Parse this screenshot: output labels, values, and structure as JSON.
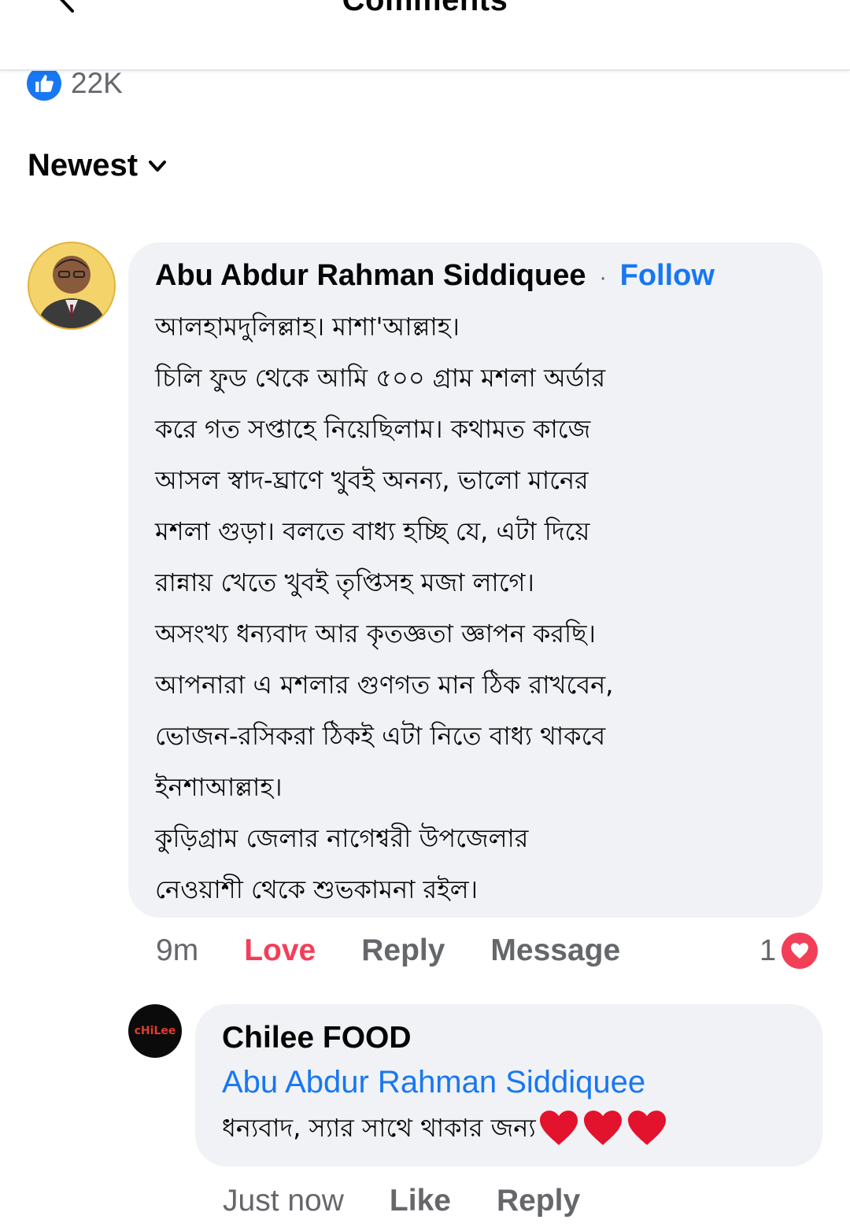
{
  "header": {
    "title": "Comments"
  },
  "post": {
    "reaction_count": "22K"
  },
  "sort": {
    "label": "Newest"
  },
  "comment": {
    "author": "Abu Abdur Rahman Siddiquee",
    "separator": "·",
    "follow_label": "Follow",
    "lines": [
      "আলহামদুলিল্লাহ। মাশা'আল্লাহ।",
      "চিলি ফুড থেকে আমি ৫০০ গ্রাম মশলা অর্ডার",
      "করে গত সপ্তাহে নিয়েছিলাম। কথামত কাজে",
      "আসল স্বাদ-ঘ্রাণে খুবই অনন্য, ভালো মানের",
      "মশলা গুড়া। বলতে বাধ্য হচ্ছি যে, এটা দিয়ে",
      "রান্নায় খেতে খুবই তৃপ্তিসহ মজা লাগে।",
      "অসংখ্য ধন্যবাদ আর কৃতজ্ঞতা জ্ঞাপন করছি।",
      "আপনারা এ মশলার গুণগত মান ঠিক রাখবেন,",
      "ভোজন-রসিকরা ঠিকই এটা নিতে বাধ্য থাকবে",
      "ইনশাআল্লাহ।",
      "কুড়িগ্রাম জেলার নাগেশ্বরী উপজেলার",
      "নেওয়াশী  থেকে শুভকামনা রইল।"
    ],
    "time": "9m",
    "love_label": "Love",
    "reply_label": "Reply",
    "message_label": "Message",
    "reaction_count": "1",
    "reaction_icon": "heart-icon"
  },
  "reply": {
    "author": "Chilee FOOD",
    "avatar_logo_text": "cHiLee",
    "mention": "Abu Abdur Rahman Siddiquee",
    "text": "ধন্যবাদ, স্যার সাথে থাকার জন্য",
    "emoji": [
      "red-heart",
      "red-heart",
      "red-heart"
    ],
    "time": "Just now",
    "like_label": "Like",
    "reply_label": "Reply"
  },
  "colors": {
    "accent": "#1877f2",
    "love": "#f33e58",
    "bubble": "#f0f2f5",
    "secondary_text": "#65676b"
  }
}
